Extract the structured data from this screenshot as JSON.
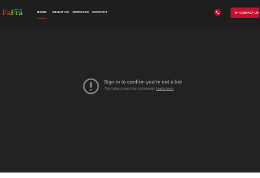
{
  "header": {
    "logo_mark_a": "Fa",
    "logo_mark_b": "Fra",
    "logo_small": "Sounds"
  },
  "nav": {
    "items": [
      {
        "label": "HOME",
        "active": true
      },
      {
        "label": "ABOUT US",
        "active": false
      },
      {
        "label": "SERVICES",
        "active": false
      },
      {
        "label": "CONTACT",
        "active": false
      }
    ]
  },
  "actions": {
    "phone_icon": "phone-icon",
    "contact_label": "CONTACT US",
    "contact_icon": "paper-plane-icon"
  },
  "video": {
    "title": "Sign in to confirm you’re not a bot",
    "subtitle": "This helps protect our community.",
    "link": "Learn more"
  },
  "colors": {
    "accent": "#c8102e",
    "background": "#1f1f1f",
    "logo_green": "#6fae3a"
  }
}
